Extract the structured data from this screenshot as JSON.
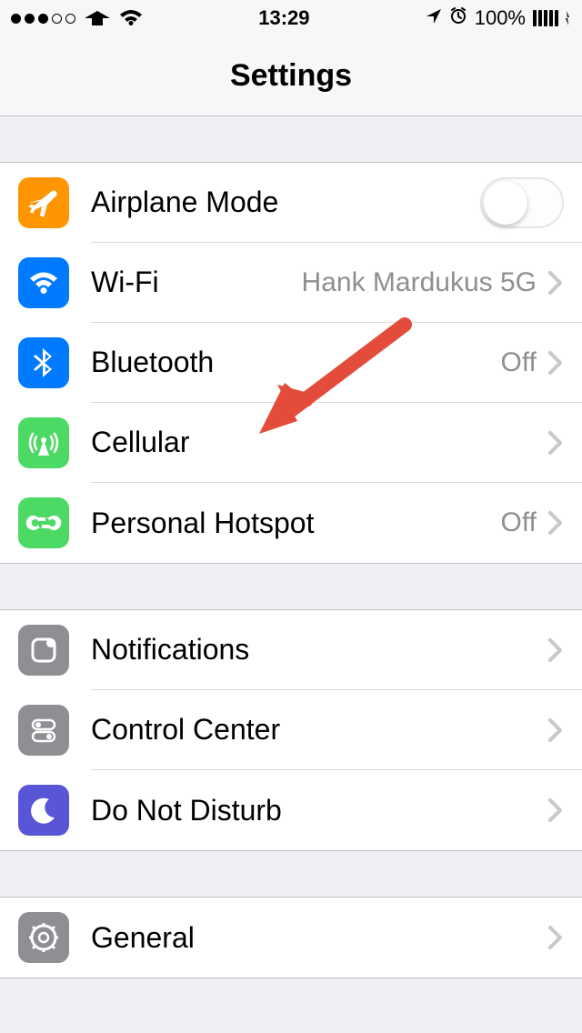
{
  "statusbar": {
    "time": "13:29",
    "battery_percent": "100%"
  },
  "nav": {
    "title": "Settings"
  },
  "groups": [
    {
      "rows": [
        {
          "icon": "airplane",
          "label": "Airplane Mode",
          "toggle": false
        },
        {
          "icon": "wifi",
          "label": "Wi-Fi",
          "value": "Hank Mardukus 5G",
          "chevron": true
        },
        {
          "icon": "bluetooth",
          "label": "Bluetooth",
          "value": "Off",
          "chevron": true
        },
        {
          "icon": "cellular",
          "label": "Cellular",
          "chevron": true
        },
        {
          "icon": "hotspot",
          "label": "Personal Hotspot",
          "value": "Off",
          "chevron": true
        }
      ]
    },
    {
      "rows": [
        {
          "icon": "notifications",
          "label": "Notifications",
          "chevron": true
        },
        {
          "icon": "controlcenter",
          "label": "Control Center",
          "chevron": true
        },
        {
          "icon": "dnd",
          "label": "Do Not Disturb",
          "chevron": true
        }
      ]
    },
    {
      "rows": [
        {
          "icon": "general",
          "label": "General",
          "chevron": true
        }
      ]
    }
  ],
  "colors": {
    "airplane": "#ff9500",
    "wifi": "#007aff",
    "bluetooth": "#007aff",
    "cellular": "#4cd964",
    "hotspot": "#4cd964",
    "notifications": "#8e8e93",
    "controlcenter": "#8e8e93",
    "dnd": "#5856d6",
    "general": "#8e8e93"
  }
}
